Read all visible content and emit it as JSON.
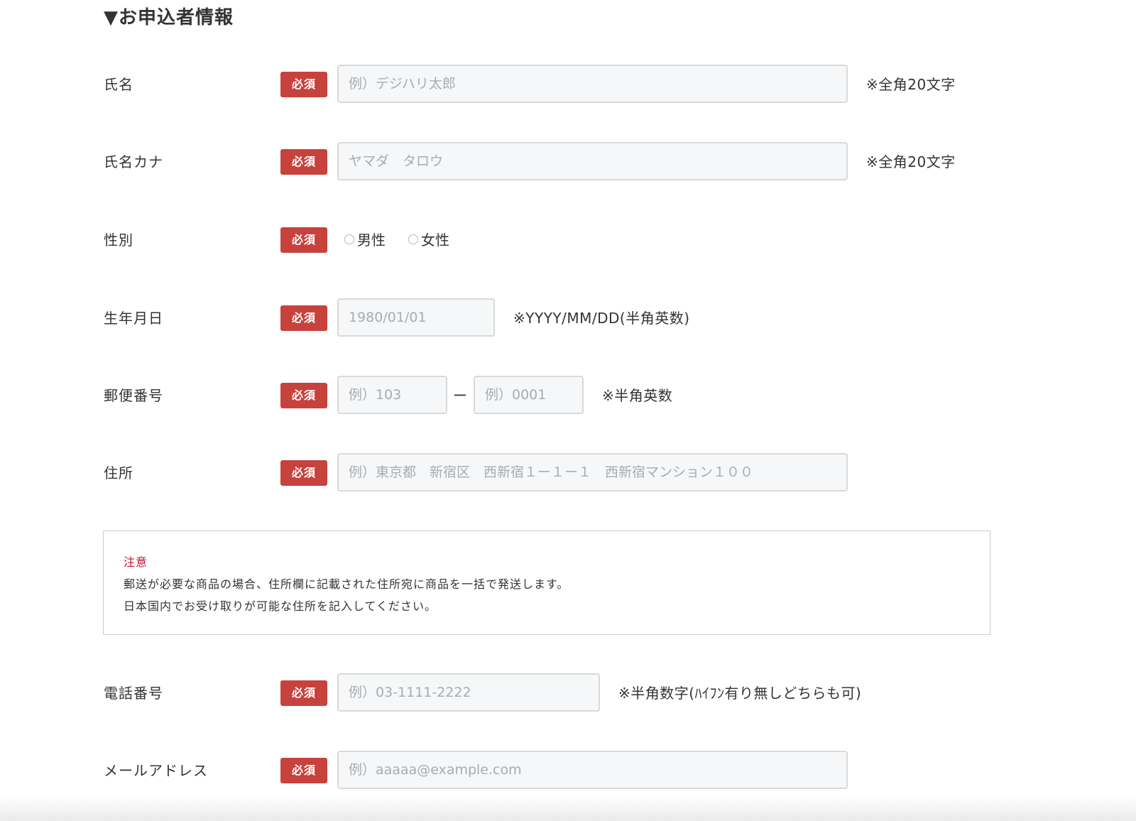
{
  "section": {
    "heading": "▼お申込者情報"
  },
  "required_label": "必須",
  "fields": {
    "name": {
      "label": "氏名",
      "placeholder": "例）デジハリ太郎",
      "note": "※全角20文字"
    },
    "name_kana": {
      "label": "氏名カナ",
      "placeholder": "ヤマダ　タロウ",
      "note": "※全角20文字"
    },
    "gender": {
      "label": "性別",
      "options": [
        "男性",
        "女性"
      ]
    },
    "birthday": {
      "label": "生年月日",
      "placeholder": "1980/01/01",
      "note": "※YYYY/MM/DD(半角英数)"
    },
    "postal": {
      "label": "郵便番号",
      "placeholder_first": "例）103",
      "separator": "ー",
      "placeholder_second": "例）0001",
      "note": "※半角英数"
    },
    "address": {
      "label": "住所",
      "placeholder": "例）東京都　新宿区　西新宿１ー１ー１　西新宿マンション１００"
    },
    "phone": {
      "label": "電話番号",
      "placeholder": "例）03-1111-2222",
      "note": "※半角数字(ﾊｲﾌﾝ有り無しどちらも可)"
    },
    "email": {
      "label": "メールアドレス",
      "placeholder": "例）aaaaa@example.com"
    }
  },
  "notice": {
    "title": "注意",
    "line1": "郵送が必要な商品の場合、住所欄に記載された住所宛に商品を一括で発送します。",
    "line2": "日本国内でお受け取りが可能な住所を記入してください。"
  },
  "colors": {
    "required_badge": "#c8423d",
    "notice_title": "#c8102e",
    "input_background": "#f6f7f8",
    "input_border": "#d9d9d9"
  }
}
